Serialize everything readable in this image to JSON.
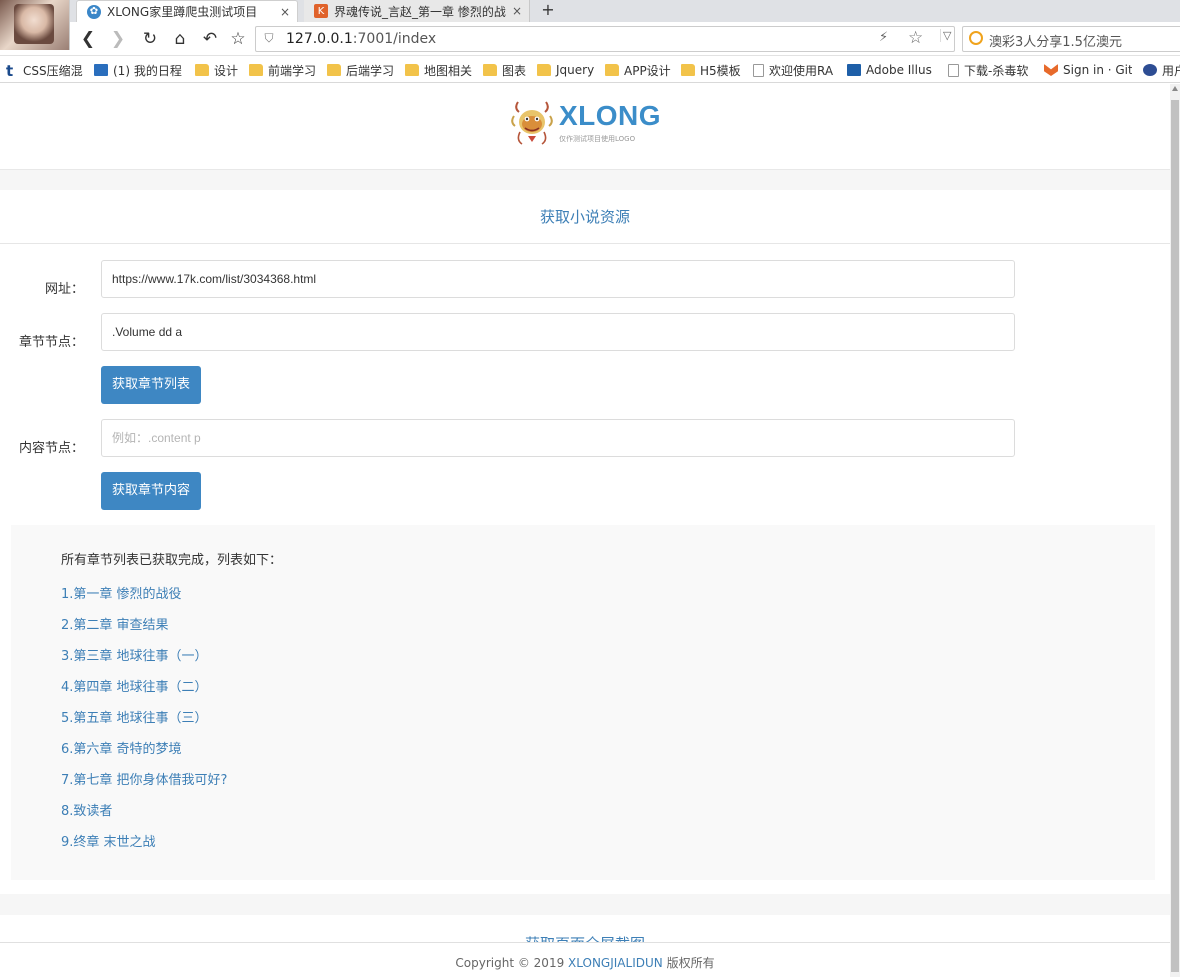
{
  "browser": {
    "tabs": [
      {
        "title": "XLONG家里蹲爬虫测试项目",
        "close": "×"
      },
      {
        "title": "界魂传说_言赵_第一章 惨烈的战",
        "close": "×"
      }
    ],
    "new_tab": "+",
    "url_host": "127.0.0.1",
    "url_rest": ":7001/index",
    "search_text": "澳彩3人分享1.5亿澳元",
    "bookmarks": [
      "CSS压缩混",
      "(1) 我的日程",
      "设计",
      "前端学习",
      "后端学习",
      "地图相关",
      "图表",
      "Jquery",
      "APP设计",
      "H5模板",
      "欢迎使用RA",
      "Adobe Illus",
      "下载-杀毒软",
      "Sign in · Git",
      "用户"
    ]
  },
  "header": {
    "logo_text": "XLONG",
    "logo_subtext": "仅作测试项目使用LOGO"
  },
  "form": {
    "title": "获取小说资源",
    "url_label": "网址：",
    "url_value": "https://www.17k.com/list/3034368.html",
    "chapter_node_label": "章节节点：",
    "chapter_node_value": ".Volume dd a",
    "get_chapters_button": "获取章节列表",
    "content_node_label": "内容节点：",
    "content_node_placeholder": "例如：.content p",
    "get_content_button": "获取章节内容"
  },
  "results": {
    "heading": "所有章节列表已获取完成，列表如下：",
    "chapters": [
      "1.第一章 惨烈的战役",
      "2.第二章 审查结果",
      "3.第三章 地球往事（一）",
      "4.第四章 地球往事（二）",
      "5.第五章 地球往事（三）",
      "6.第六章 奇特的梦境",
      "7.第七章 把你身体借我可好?",
      "8.致读者",
      "9.终章 末世之战"
    ]
  },
  "screenshot_section": {
    "title": "获取页面全屏截图"
  },
  "footer": {
    "prefix": "Copyright © 2019 ",
    "brand": "XLONGJIALIDUN",
    "suffix": " 版权所有"
  },
  "colors": {
    "accent": "#3e87c3",
    "link": "#3d7fb6",
    "page_bg": "#f6f6f6"
  },
  "icons": {
    "back": "chevron-left-icon",
    "forward": "chevron-right-icon",
    "reload": "reload-icon",
    "home": "home-icon",
    "undo": "undo-icon",
    "bookmark": "star-icon",
    "security": "shield-icon",
    "lightning": "lightning-icon",
    "folder": "folder-icon"
  }
}
